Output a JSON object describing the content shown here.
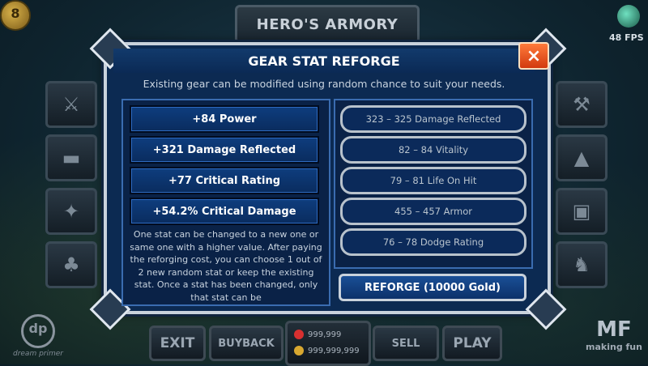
{
  "hud": {
    "title": "HERO'S ARMORY",
    "fps": "48 FPS",
    "coin_badge": "8"
  },
  "dialog": {
    "title": "GEAR STAT REFORGE",
    "subtitle": "Existing gear can be modified using random chance to suit your needs.",
    "close_icon": "×",
    "current_stats": [
      "+84 Power",
      "+321 Damage Reflected",
      "+77 Critical Rating",
      "+54.2% Critical Damage"
    ],
    "description": "One stat can be changed to a new one or same one with a higher value. After paying the reforging cost, you can choose 1 out of 2 new random stat or keep the existing stat. Once a stat has been changed, only that stat can be",
    "stat_ranges": [
      "323 – 325 Damage Reflected",
      "82 – 84 Vitality",
      "79 – 81 Life On Hit",
      "455 – 457 Armor",
      "76 – 78 Dodge Rating"
    ],
    "reforge_label": "REFORGE (10000 Gold)"
  },
  "bottom_bar": {
    "exit": "EXIT",
    "buyback": "BUYBACK",
    "gems": "999,999",
    "gold": "999,999,999",
    "sell": "SELL",
    "play": "PLAY"
  },
  "logos": {
    "left_mark": "dp",
    "left_text": "dream primer",
    "right_mark": "MF",
    "right_text": "making fun"
  },
  "colors": {
    "dialog_bg": "#0c2a52",
    "close_button": "#e2501c",
    "button_blue": "#0e3d7e"
  }
}
